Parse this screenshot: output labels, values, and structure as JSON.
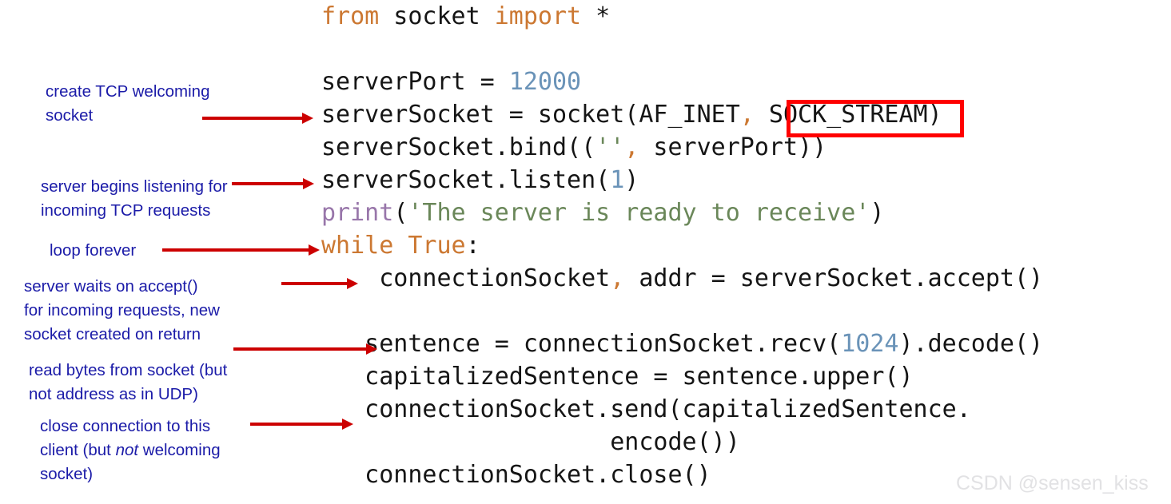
{
  "code": {
    "language": "python",
    "lines": [
      {
        "id": "line-import",
        "tokens": [
          {
            "t": "from",
            "c": "kw"
          },
          {
            "t": " socket ",
            "c": "def"
          },
          {
            "t": "import",
            "c": "kw"
          },
          {
            "t": " *",
            "c": "def"
          }
        ]
      },
      {
        "id": "line-blank-1",
        "tokens": [
          {
            "t": " ",
            "c": "def"
          }
        ]
      },
      {
        "id": "line-serverport",
        "tokens": [
          {
            "t": "serverPort = ",
            "c": "def"
          },
          {
            "t": "12000",
            "c": "num"
          }
        ]
      },
      {
        "id": "line-serversocket",
        "tokens": [
          {
            "t": "serverSocket = socket(AF_INET",
            "c": "def"
          },
          {
            "t": ",",
            "c": "op"
          },
          {
            "t": " SOCK_STREAM)",
            "c": "def"
          }
        ]
      },
      {
        "id": "line-bind",
        "tokens": [
          {
            "t": "serverSocket.bind((",
            "c": "def"
          },
          {
            "t": "''",
            "c": "str"
          },
          {
            "t": ",",
            "c": "op"
          },
          {
            "t": " serverPort))",
            "c": "def"
          }
        ]
      },
      {
        "id": "line-listen",
        "tokens": [
          {
            "t": "serverSocket.listen(",
            "c": "def"
          },
          {
            "t": "1",
            "c": "num"
          },
          {
            "t": ")",
            "c": "def"
          }
        ]
      },
      {
        "id": "line-print",
        "tokens": [
          {
            "t": "print",
            "c": "fn"
          },
          {
            "t": "(",
            "c": "def"
          },
          {
            "t": "'The server is ready to receive'",
            "c": "str"
          },
          {
            "t": ")",
            "c": "def"
          }
        ]
      },
      {
        "id": "line-while",
        "tokens": [
          {
            "t": "while",
            "c": "kw"
          },
          {
            "t": " ",
            "c": "def"
          },
          {
            "t": "True",
            "c": "kw"
          },
          {
            "t": ":",
            "c": "def"
          }
        ]
      },
      {
        "id": "line-accept",
        "tokens": [
          {
            "t": "    connectionSocket",
            "c": "def"
          },
          {
            "t": ",",
            "c": "op"
          },
          {
            "t": " addr = serverSocket.accept()",
            "c": "def"
          }
        ]
      },
      {
        "id": "line-blank-2",
        "tokens": [
          {
            "t": " ",
            "c": "def"
          }
        ]
      },
      {
        "id": "line-recv",
        "tokens": [
          {
            "t": "   sentence = connectionSocket.recv(",
            "c": "def"
          },
          {
            "t": "1024",
            "c": "num"
          },
          {
            "t": ").decode()",
            "c": "def"
          }
        ]
      },
      {
        "id": "line-upper",
        "tokens": [
          {
            "t": "   capitalizedSentence = sentence.upper()",
            "c": "def"
          }
        ]
      },
      {
        "id": "line-send",
        "tokens": [
          {
            "t": "   connectionSocket.send(capitalizedSentence.",
            "c": "def"
          }
        ]
      },
      {
        "id": "line-encode",
        "tokens": [
          {
            "t": "                    encode())",
            "c": "def"
          }
        ]
      },
      {
        "id": "line-close",
        "tokens": [
          {
            "t": "   connectionSocket.close()",
            "c": "def"
          }
        ]
      }
    ]
  },
  "annotations": [
    {
      "id": "annot-create-socket",
      "text": "create TCP welcoming\nsocket"
    },
    {
      "id": "annot-listen",
      "text": "server begins listening for\nincoming TCP requests"
    },
    {
      "id": "annot-loop-forever",
      "text": "loop forever"
    },
    {
      "id": "annot-accept",
      "text": "server waits on accept()\nfor incoming requests, new\nsocket created on return"
    },
    {
      "id": "annot-read-bytes",
      "text": "read bytes from socket (but\nnot address as in UDP)"
    },
    {
      "id": "annot-close-lead",
      "text": "close connection to this\nclient (but "
    },
    {
      "id": "annot-close-italic",
      "text": "not"
    },
    {
      "id": "annot-close-tail",
      "text": " welcoming\nsocket)"
    }
  ],
  "highlight": {
    "id": "highlight-sock-stream",
    "target_text": "SOCK_STREAM",
    "color": "#ff0000"
  },
  "watermark": {
    "text": "CSDN @sensen_kiss",
    "color": "#e2e2e4"
  },
  "palette": {
    "keyword": "#cc7832",
    "number": "#6a93b8",
    "string": "#6a8759",
    "function": "#9876aa",
    "default_text": "#151515",
    "annotation": "#1b1ba8",
    "arrow": "#cc0000",
    "highlight_box": "#ff0000",
    "background": "#ffffff"
  }
}
